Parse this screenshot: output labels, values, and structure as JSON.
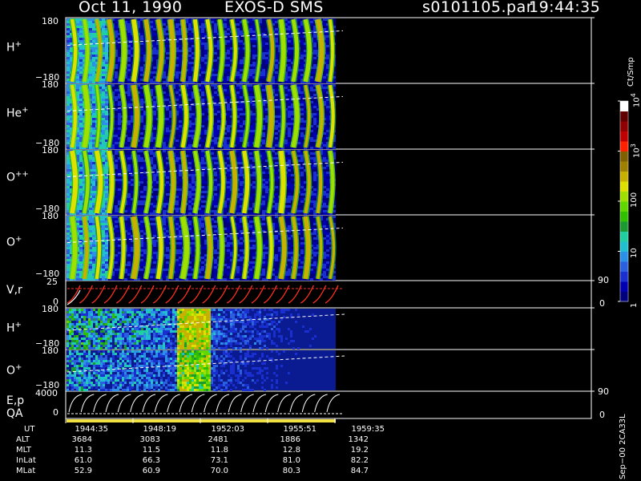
{
  "header": {
    "date": "Oct 11, 1990",
    "instrument": "EXOS-D SMS",
    "file": "s0101105.par",
    "time": "19:44:35"
  },
  "panels": [
    {
      "id": "h_plus",
      "label": "H",
      "sup": "+",
      "ymax": "180",
      "ymin": "−180"
    },
    {
      "id": "he_plus",
      "label": "He",
      "sup": "+",
      "ymax": "180",
      "ymin": "−180"
    },
    {
      "id": "o_pp",
      "label": "O",
      "sup": "++",
      "ymax": "180",
      "ymin": "−180"
    },
    {
      "id": "o_plus",
      "label": "O",
      "sup": "+",
      "ymax": "180",
      "ymin": "−180"
    },
    {
      "id": "vr",
      "label": "V,r",
      "sup": "",
      "ymax": "25",
      "ymin": "0",
      "rmax": "90",
      "rmin": "0"
    },
    {
      "id": "h_plus_2",
      "label": "H",
      "sup": "+",
      "ymax": "180",
      "ymin": "−180"
    },
    {
      "id": "o_plus_2",
      "label": "O",
      "sup": "+",
      "ymax": "180",
      "ymin": "−180"
    },
    {
      "id": "ep",
      "label": "E,p",
      "sup": "",
      "ymax": "4000",
      "ymin": "0",
      "rmax": "90",
      "rmin": "0"
    },
    {
      "id": "qa",
      "label": "QA",
      "sup": ""
    }
  ],
  "colorbar": {
    "unit": "Ct/Smp",
    "ticks": [
      {
        "label": "1",
        "frac": 0.0
      },
      {
        "label": "10",
        "frac": 0.25
      },
      {
        "label": "100",
        "frac": 0.5
      },
      {
        "label": "10",
        "sup": "3",
        "frac": 0.75
      },
      {
        "label": "10",
        "sup": "4",
        "frac": 1.0
      }
    ],
    "colors": [
      "#00007f",
      "#0000b0",
      "#1a2fd0",
      "#2a60e0",
      "#2a90e8",
      "#20c0d0",
      "#20d0a0",
      "#1a9a30",
      "#30c000",
      "#60d800",
      "#a0e000",
      "#e0e000",
      "#c8b000",
      "#a08000",
      "#806000",
      "#ff2000",
      "#c00000",
      "#900000",
      "#600000",
      "#ffffff"
    ]
  },
  "chart_data": {
    "type": "heatmap",
    "title": "Oct 11, 1990   EXOS-D SMS",
    "xlabel": "UT",
    "x_ticks": [
      "1944:35",
      "1948:19",
      "1952:03",
      "1955:51",
      "1959:35"
    ],
    "ephemeris": [
      {
        "name": "UT",
        "values": [
          "1944:35",
          "1948:19",
          "1952:03",
          "1955:51",
          "1959:35"
        ]
      },
      {
        "name": "ALT",
        "values": [
          "3684",
          "3083",
          "2481",
          "1886",
          "1342"
        ]
      },
      {
        "name": "MLT",
        "values": [
          "11.3",
          "11.5",
          "11.8",
          "12.8",
          "19.2"
        ]
      },
      {
        "name": "InLat",
        "values": [
          "61.0",
          "66.3",
          "73.1",
          "81.0",
          "82.2"
        ]
      },
      {
        "name": "MLat",
        "values": [
          "52.9",
          "60.9",
          "70.0",
          "80.3",
          "84.7"
        ]
      }
    ],
    "spin_pulses_count": 22
  },
  "footer": {
    "stamp": "Sep−00  2CA33L"
  }
}
